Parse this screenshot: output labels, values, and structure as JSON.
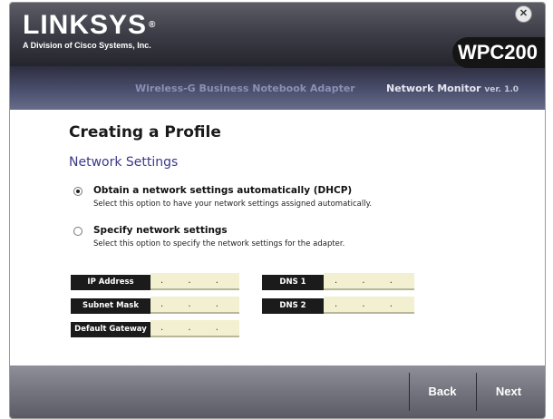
{
  "header": {
    "brand": "LINKSYS",
    "brand_mark": "®",
    "brand_sub": "A Division of Cisco Systems, Inc.",
    "model": "WPC200",
    "product_line": "Wireless-G Business Notebook Adapter",
    "monitor_label": "Network Monitor",
    "version": "ver. 1.0",
    "close_icon": "close-icon"
  },
  "main": {
    "title": "Creating a Profile",
    "subtitle": "Network Settings",
    "options": [
      {
        "label": "Obtain a network settings automatically (DHCP)",
        "description": "Select this option to have your network settings assigned automatically.",
        "checked": true
      },
      {
        "label": "Specify network settings",
        "description": "Select this option to specify the network settings for the adapter.",
        "checked": false
      }
    ],
    "fields": {
      "ip_address": {
        "label": "IP Address",
        "value": ". . ."
      },
      "subnet_mask": {
        "label": "Subnet Mask",
        "value": ". . ."
      },
      "default_gateway": {
        "label": "Default Gateway",
        "value": ". . ."
      },
      "dns1": {
        "label": "DNS 1",
        "value": ". . ."
      },
      "dns2": {
        "label": "DNS 2",
        "value": ". . ."
      }
    }
  },
  "footer": {
    "back_label": "Back",
    "next_label": "Next"
  },
  "colors": {
    "accent": "#3a3a8a",
    "field_background": "#f2f0d0",
    "label_background": "#1b1b1b"
  }
}
